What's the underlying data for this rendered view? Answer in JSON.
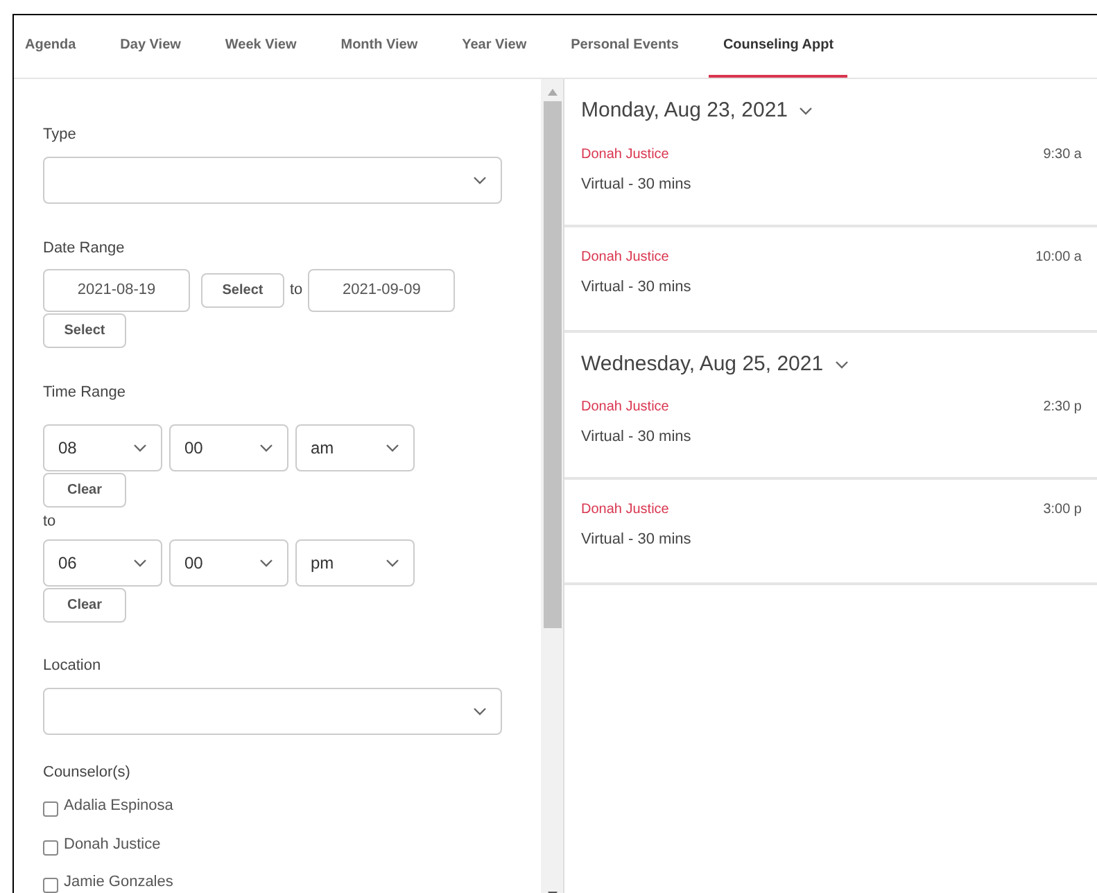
{
  "tabs": [
    {
      "label": "Agenda",
      "selected": false
    },
    {
      "label": "Day View",
      "selected": false
    },
    {
      "label": "Week View",
      "selected": false
    },
    {
      "label": "Month View",
      "selected": false
    },
    {
      "label": "Year View",
      "selected": false
    },
    {
      "label": "Personal Events",
      "selected": false
    },
    {
      "label": "Counseling Appt",
      "selected": true
    }
  ],
  "filters": {
    "type": {
      "label": "Type"
    },
    "date_range": {
      "label": "Date Range",
      "start": "2021-08-19",
      "start_select_label": "Select",
      "end": "2021-09-09",
      "end_select_label": "Select",
      "separator": "to"
    },
    "time_range": {
      "label": "Time Range",
      "separator": "to",
      "start": {
        "hour": "08",
        "minute": "00",
        "period": "am",
        "clear_label": "Clear"
      },
      "end": {
        "hour": "06",
        "minute": "00",
        "period": "pm",
        "clear_label": "Clear"
      }
    },
    "location": {
      "label": "Location"
    },
    "counselors": {
      "label": "Counselor(s)",
      "items": [
        {
          "name": "Adalia Espinosa",
          "checked": false
        },
        {
          "name": "Donah Justice",
          "checked": false
        },
        {
          "name": "Jamie Gonzales",
          "checked": false
        }
      ]
    }
  },
  "agenda": [
    {
      "date": "Monday, Aug 23, 2021",
      "events": [
        {
          "name": "Donah Justice",
          "detail": "Virtual - 30 mins",
          "time": "9:30 a"
        },
        {
          "name": "Donah Justice",
          "detail": "Virtual - 30 mins",
          "time": "10:00 a"
        }
      ]
    },
    {
      "date": "Wednesday, Aug 25, 2021",
      "events": [
        {
          "name": "Donah Justice",
          "detail": "Virtual - 30 mins",
          "time": "2:30 p"
        },
        {
          "name": "Donah Justice",
          "detail": "Virtual - 30 mins",
          "time": "3:00 p"
        }
      ]
    }
  ]
}
